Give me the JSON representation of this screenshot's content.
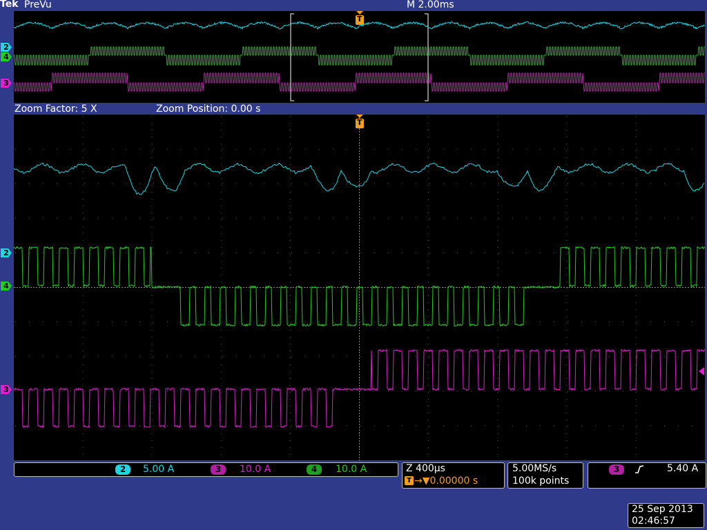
{
  "header": {
    "brand": "Tek",
    "mode": "PreVu",
    "timebase": "M 2.00ms"
  },
  "trigger_marker": "T",
  "zoom": {
    "factor": "Zoom Factor: 5 X",
    "position": "Zoom Position: 0.00 s"
  },
  "channels": [
    {
      "id": "2",
      "color": "#22d3e0",
      "scale": "5.00 A"
    },
    {
      "id": "3",
      "color": "#e020d0",
      "scale": "10.0 A"
    },
    {
      "id": "4",
      "color": "#20d020",
      "scale": "10.0 A"
    }
  ],
  "zoom_box": {
    "z_label": "Z 400µs",
    "trigger_icon": "T",
    "trigger_pos": "→▼0.00000 s"
  },
  "acquisition": {
    "rate": "5.00MS/s",
    "points": "100k points"
  },
  "trigger": {
    "source": "3",
    "slope_icon": "rising-edge-icon",
    "level": "5.40 A"
  },
  "datetime": {
    "date": "25 Sep  2013",
    "time": "02:46:57"
  },
  "colors": {
    "background": "#303a8a",
    "ch2": "#22d3e0",
    "ch3": "#e020d0",
    "ch4": "#20d020",
    "trigger": "#f0a020"
  }
}
